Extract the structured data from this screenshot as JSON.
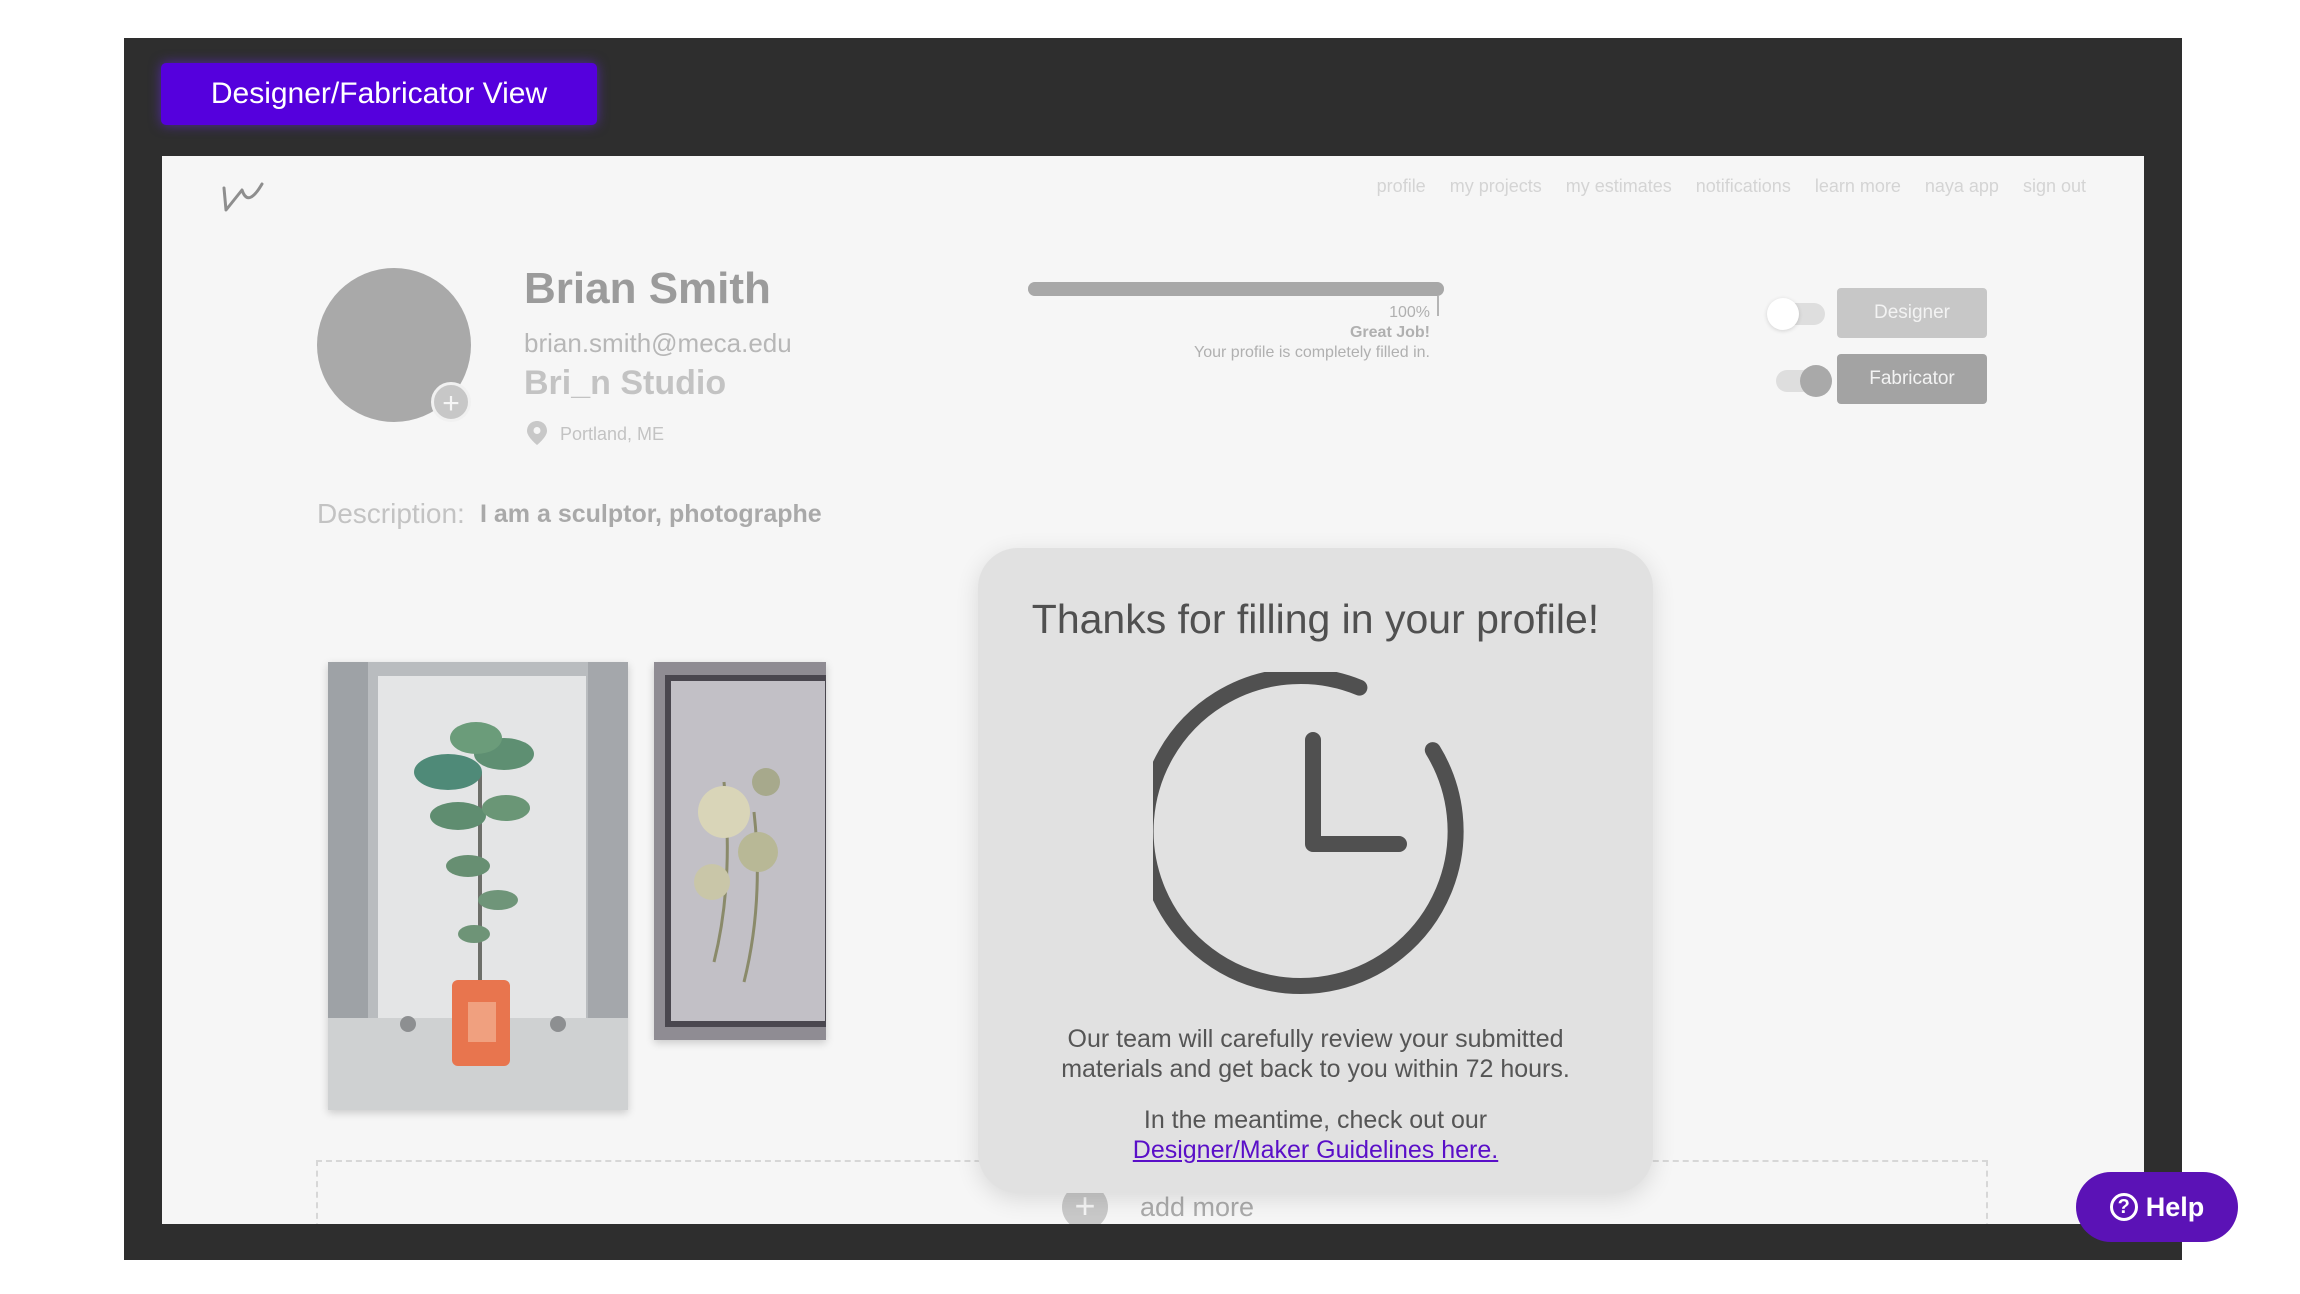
{
  "view_label": "Designer/Fabricator View",
  "nav": {
    "items": [
      "profile",
      "my projects",
      "my estimates",
      "notifications",
      "learn more",
      "naya app",
      "sign out"
    ]
  },
  "profile": {
    "name": "Brian Smith",
    "email": "brian.smith@meca.edu",
    "studio": "Bri_n Studio",
    "location": "Portland, ME",
    "description_label": "Description:",
    "description": "I am a sculptor, photographe"
  },
  "progress": {
    "value": 1.0,
    "percent_label": "100%",
    "status": "Great Job!",
    "message": "Your profile is completely filled in."
  },
  "roles": {
    "designer": {
      "label": "Designer",
      "active": false
    },
    "fabricator": {
      "label": "Fabricator",
      "active": true
    }
  },
  "portfolio": {
    "add_more_label": "add more"
  },
  "modal": {
    "title": "Thanks for filling in your profile!",
    "body_line1": "Our team will carefully review your submitted",
    "body_line2": "materials and get back to you within 72 hours.",
    "meantime": "In the meantime, check out our",
    "link_text": "Designer/Maker Guidelines here."
  },
  "help": {
    "label": "Help",
    "icon": "question-icon"
  },
  "colors": {
    "accent": "#5500dd",
    "help": "#5b12b6",
    "link": "#5a0fc8",
    "frame": "#2e2e2e"
  }
}
